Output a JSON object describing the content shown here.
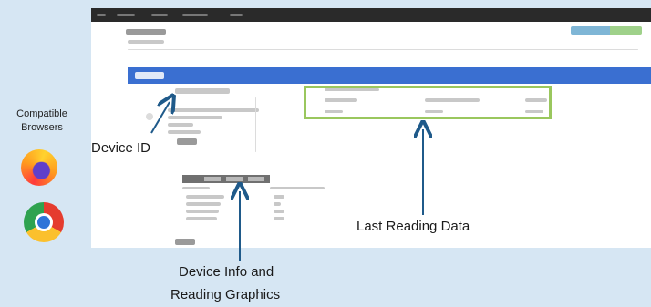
{
  "sidebar": {
    "compatible_label": "Compatible Browsers",
    "browsers": [
      "Firefox",
      "Chrome"
    ]
  },
  "annotations": {
    "device_id": "Device ID",
    "last_reading": "Last Reading Data",
    "device_info_line1": "Device Info and",
    "device_info_line2": "Reading Graphics"
  },
  "colors": {
    "background": "#d6e6f3",
    "arrow": "#1f5a8a",
    "highlight": "#9ac75e",
    "header_bar": "#3a6fd1"
  },
  "icons": [
    "firefox-icon",
    "chrome-icon"
  ]
}
